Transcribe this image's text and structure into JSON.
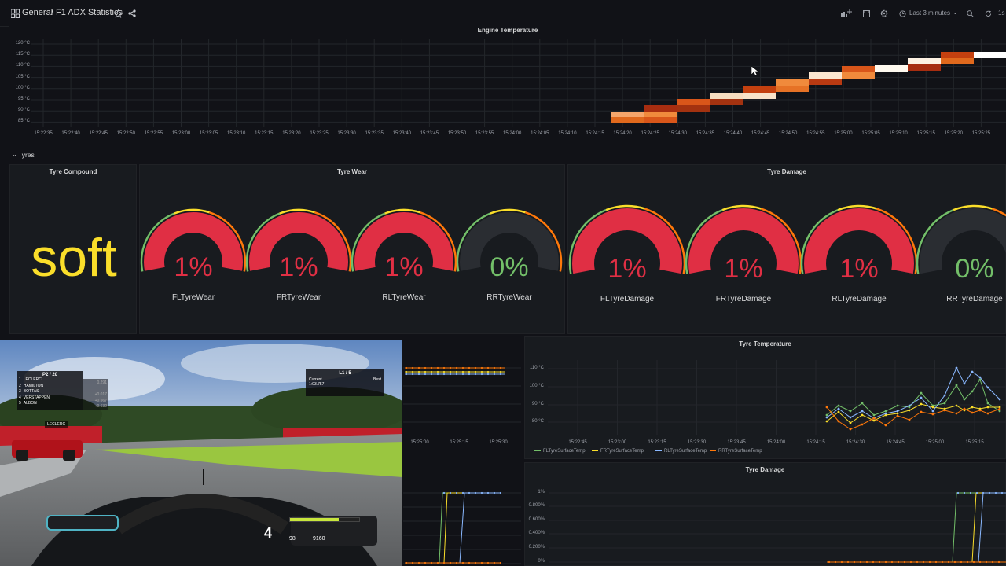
{
  "header": {
    "dashboards_icon": "grid-icon",
    "folder": "General",
    "separator": "/",
    "title": "F1 ADX Statistics",
    "time_range": "Last 3 minutes",
    "refresh": "1s"
  },
  "colors": {
    "bg": "#111217",
    "panel": "#181b1f",
    "gauge_red": "#e02f44",
    "gauge_green": "#73bf69",
    "soft_yellow": "#fade2a"
  },
  "engine_panel": {
    "title": "Engine Temperature",
    "y_ticks": [
      "120 °C",
      "115 °C",
      "110 °C",
      "105 °C",
      "100 °C",
      "95 °C",
      "90 °C",
      "85 °C"
    ],
    "x_ticks": [
      "15:22:35",
      "15:22:40",
      "15:22:45",
      "15:22:50",
      "15:22:55",
      "15:23:00",
      "15:23:05",
      "15:23:10",
      "15:23:15",
      "15:23:20",
      "15:23:25",
      "15:23:30",
      "15:23:35",
      "15:23:40",
      "15:23:45",
      "15:23:50",
      "15:23:55",
      "15:24:00",
      "15:24:05",
      "15:24:10",
      "15:24:15",
      "15:24:20",
      "15:24:25",
      "15:24:30",
      "15:24:35",
      "15:24:40",
      "15:24:45",
      "15:24:50",
      "15:24:55",
      "15:25:00",
      "15:25:05",
      "15:25:10",
      "15:25:15",
      "15:25:20",
      "15:25:25"
    ]
  },
  "tyres_row": {
    "title": "Tyres"
  },
  "compound_panel": {
    "title": "Tyre Compound",
    "value": "soft"
  },
  "wear_panel": {
    "title": "Tyre Wear",
    "gauges": [
      {
        "label": "FLTyreWear",
        "value": "1%",
        "level": 0.01
      },
      {
        "label": "FRTyreWear",
        "value": "1%",
        "level": 0.01
      },
      {
        "label": "RLTyreWear",
        "value": "1%",
        "level": 0.01
      },
      {
        "label": "RRTyreWear",
        "value": "0%",
        "level": 0.0
      }
    ]
  },
  "damage_panel": {
    "title": "Tyre Damage",
    "gauges": [
      {
        "label": "FLTyreDamage",
        "value": "1%",
        "level": 0.01
      },
      {
        "label": "FRTyreDamage",
        "value": "1%",
        "level": 0.01
      },
      {
        "label": "RLTyreDamage",
        "value": "1%",
        "level": 0.01
      },
      {
        "label": "RRTyreDamage",
        "value": "0%",
        "level": 0.0
      }
    ]
  },
  "small_temp_panel": {
    "x_ticks": [
      "15:25:00",
      "15:25:15",
      "15:25:30"
    ]
  },
  "tyre_temp_panel": {
    "title": "Tyre Temperature",
    "y_ticks": [
      "110 °C",
      "100 °C",
      "90 °C",
      "80 °C"
    ],
    "x_ticks": [
      "15:22:45",
      "15:23:00",
      "15:23:15",
      "15:23:30",
      "15:23:45",
      "15:24:00",
      "15:24:15",
      "15:24:30",
      "15:24:45",
      "15:25:00",
      "15:25:15"
    ],
    "legend": [
      {
        "name": "FLTyreSurfaceTemp",
        "color": "#73bf69"
      },
      {
        "name": "FRTyreSurfaceTemp",
        "color": "#fade2a"
      },
      {
        "name": "RLTyreSurfaceTemp",
        "color": "#8ab8ff"
      },
      {
        "name": "RRTyreSurfaceTemp",
        "color": "#ff780a"
      }
    ]
  },
  "tyre_damage_panel": {
    "title": "Tyre Damage",
    "y_ticks": [
      "1%",
      "0.800%",
      "0.600%",
      "0.400%",
      "0.200%",
      "0%"
    ]
  },
  "game_hud": {
    "position": "P2 / 20",
    "drivers": [
      "LECLERC",
      "HAMILTON",
      "BOTTAS",
      "VERSTAPPEN",
      "ALBON"
    ],
    "gaps": [
      "0.291",
      "",
      "+0.017",
      "+0.567",
      "+0.632"
    ],
    "lap": "L1 / 5",
    "current_label": "Current",
    "best_label": "Best",
    "current_time": "1:03.757",
    "gear": "4",
    "speed": "98",
    "rpm": "9160",
    "car_label": "LECLERC"
  }
}
